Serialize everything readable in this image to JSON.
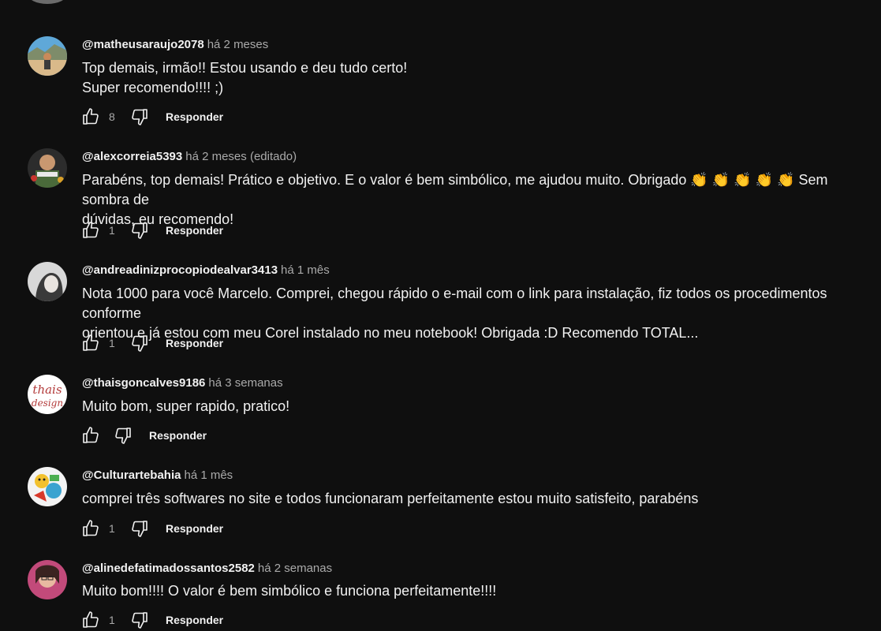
{
  "comments": [
    {
      "author": "@matheusaraujo2078",
      "time": "há 2 meses",
      "lines": [
        "Top demais, irmão!! Estou usando e deu tudo certo!",
        "Super recomendo!!!! ;)"
      ],
      "likes": "8",
      "reply_label": "Responder"
    },
    {
      "author": "@alexcorreia5393",
      "time": "há 2 meses (editado)",
      "lines": [
        "Parabéns, top demais! Prático e objetivo. E o valor é bem simbólico, me ajudou muito. Obrigado 👏 👏 👏 👏 👏 Sem sombra de",
        "dúvidas, eu recomendo!"
      ],
      "likes": "1",
      "reply_label": "Responder"
    },
    {
      "author": "@andreadinizprocopiodealvar3413",
      "time": "há 1 mês",
      "lines": [
        "Nota 1000 para você Marcelo. Comprei, chegou rápido o e-mail com o link para instalação, fiz todos os procedimentos conforme",
        "orientou e já estou com meu Corel instalado no meu notebook! Obrigada :D Recomendo TOTAL..."
      ],
      "likes": "1",
      "reply_label": "Responder"
    },
    {
      "author": "@thaisgoncalves9186",
      "time": "há 3 semanas",
      "lines": [
        "Muito bom, super rapido, pratico!"
      ],
      "likes": "",
      "reply_label": "Responder",
      "avatar_text": [
        "thais",
        "design"
      ]
    },
    {
      "author": "@Culturartebahia",
      "time": "há 1 mês",
      "lines": [
        "comprei três softwares no site e todos funcionaram perfeitamente estou muito satisfeito, parabéns"
      ],
      "likes": "1",
      "reply_label": "Responder"
    },
    {
      "author": "@alinedefatimadossantos2582",
      "time": "há 2 semanas",
      "lines": [
        "Muito bom!!!! O valor é bem simbólico e funciona perfeitamente!!!!"
      ],
      "likes": "1",
      "reply_label": "Responder"
    }
  ],
  "icons": {
    "like": "thumbs-up-icon",
    "dislike": "thumbs-down-icon"
  },
  "colors": {
    "background": "#0f0f0f",
    "text": "#f1f1f1",
    "secondary": "#aaaaaa"
  }
}
